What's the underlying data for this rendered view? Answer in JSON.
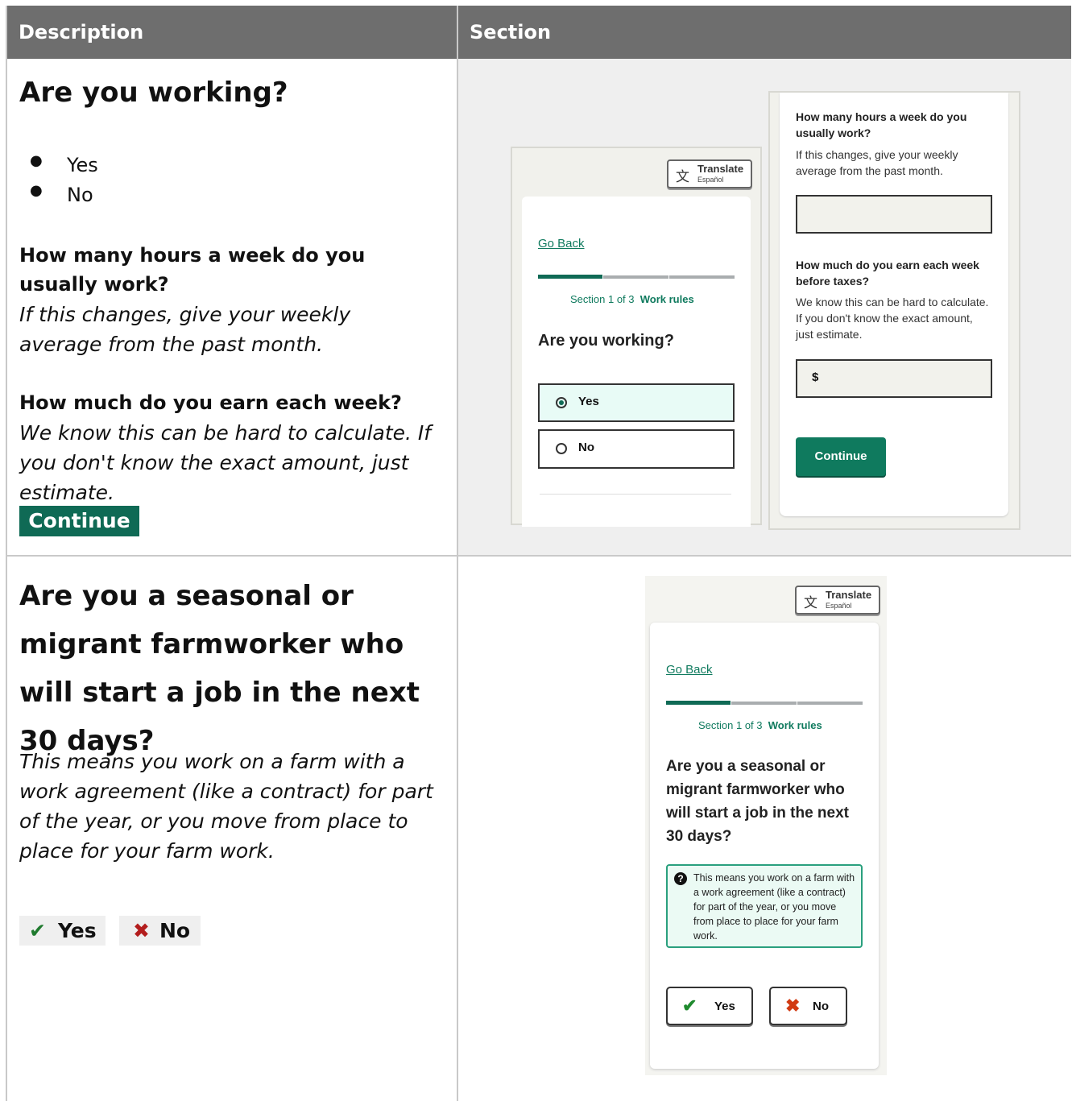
{
  "table": {
    "headers": [
      "Description",
      "Section"
    ]
  },
  "row1": {
    "question": "Are you working?",
    "options": [
      "Yes",
      "No"
    ],
    "hours_q": "How many hours a week do you usually work?",
    "hours_help": "If this changes, give your weekly average from the past month.",
    "earn_q": "How much do you earn each week?",
    "earn_help": "We know this can be hard to calculate. If you don't know the exact amount, just estimate.",
    "continue": "Continue",
    "mock_left": {
      "translate": "Translate",
      "translate_sub": "Español",
      "go_back": "Go Back",
      "section_prefix": "Section 1 of 3",
      "section_name": "Work rules",
      "question": "Are you working?",
      "opt_yes": "Yes",
      "opt_no": "No"
    },
    "mock_right": {
      "hours_q": "How many hours a week do you usually work?",
      "hours_help": "If this changes, give your weekly average from the past month.",
      "earn_q": "How much do you earn each week before taxes?",
      "earn_help": "We know this can be hard to calculate. If you don't know the exact amount, just estimate.",
      "currency": "$",
      "continue": "Continue"
    }
  },
  "row2": {
    "question": "Are you a seasonal or migrant farmworker who will start a job in the next 30 days?",
    "help": "This means you work on a farm with a work agreement (like a contract) for part of the year, or you move from place to place for your farm work.",
    "yes": "Yes",
    "no": "No",
    "yes_mark": "✔",
    "no_mark": "✖",
    "mock": {
      "translate": "Translate",
      "translate_sub": "Español",
      "go_back": "Go Back",
      "section_prefix": "Section 1 of 3",
      "section_name": "Work rules",
      "question": "Are you a seasonal or migrant farmworker who will start a job in the next 30 days?",
      "hint": "This means you work on a farm with a work agreement (like a contract) for part of the year, or you move from place to place for your farm work.",
      "yes": "Yes",
      "no": "No"
    }
  },
  "colors": {
    "header_bg": "#6e6e6e",
    "brand_green": "#0f6a55",
    "check_green": "#1f7a2e",
    "cross_red": "#b31d1d"
  }
}
